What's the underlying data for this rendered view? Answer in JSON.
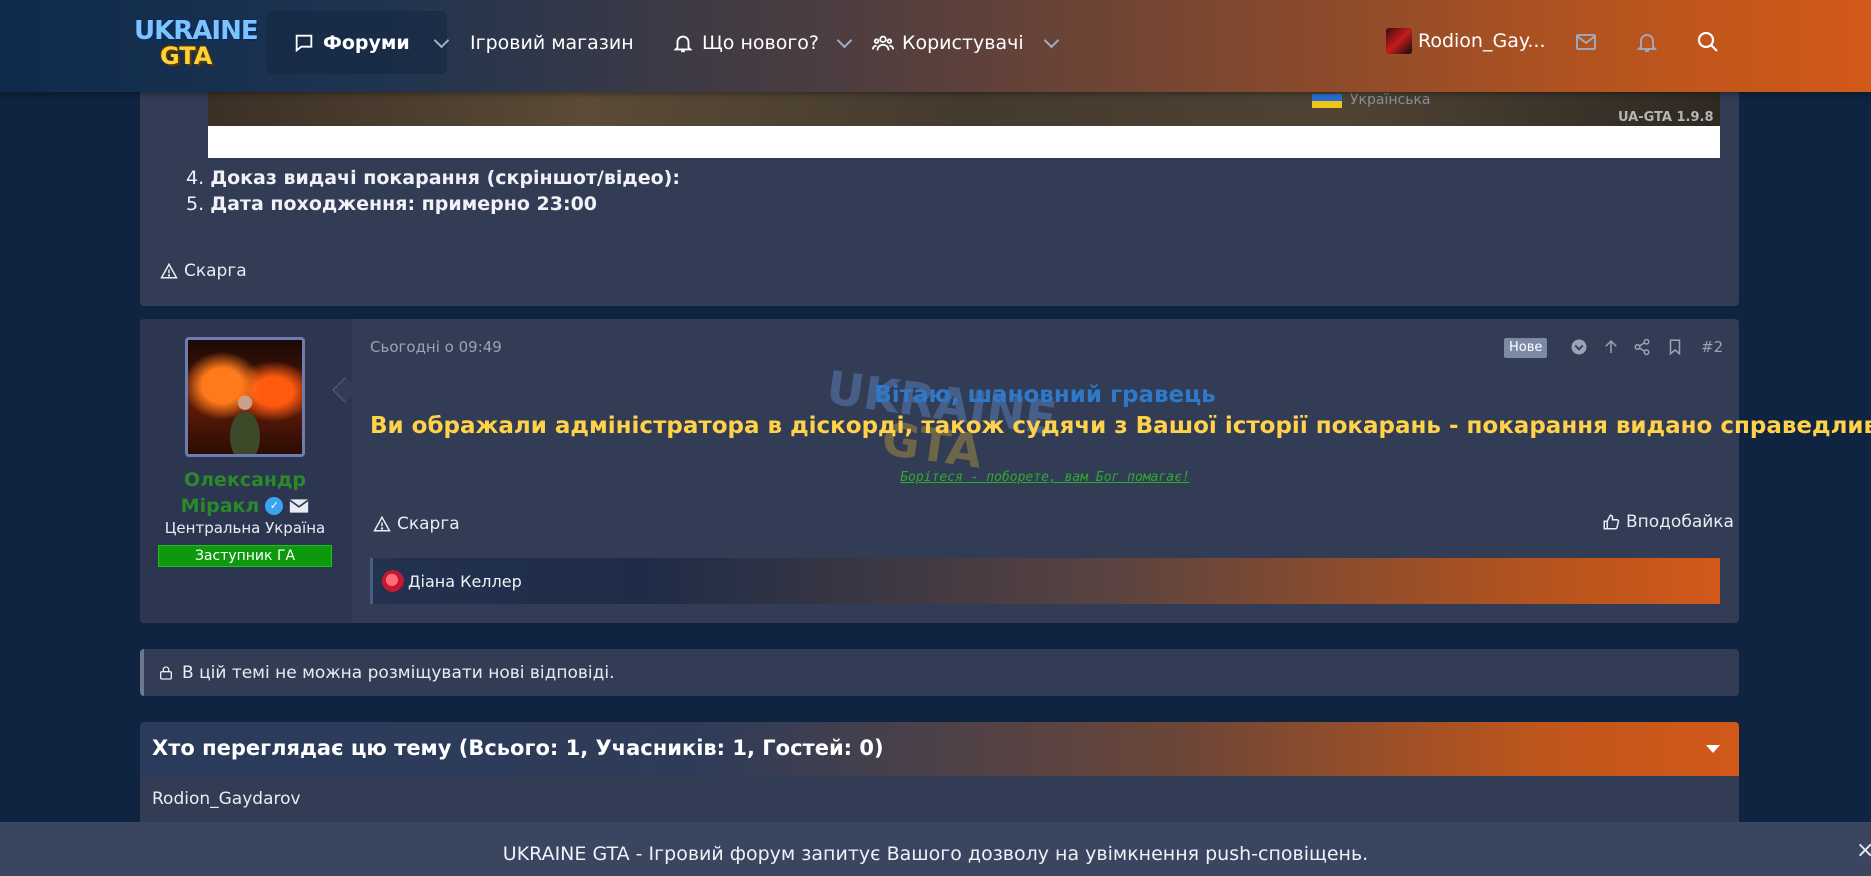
{
  "header": {
    "logo": {
      "line1": "UKRAINE",
      "line2": "GTA"
    },
    "nav": [
      {
        "label": "Форуми",
        "icon": "chat-bubble-icon",
        "dropdown": true,
        "active": true
      },
      {
        "label": "Ігровий магазин",
        "dropdown": false
      },
      {
        "label": "Що нового?",
        "icon": "bell-icon",
        "dropdown": true
      },
      {
        "label": "Користувачі",
        "icon": "users-icon",
        "dropdown": true
      }
    ],
    "user": {
      "name": "Rodion_Gay..."
    },
    "icons": [
      "envelope-icon",
      "bell-icon",
      "search-icon"
    ]
  },
  "previous_post": {
    "banner_language": "Українська",
    "banner_version": "UA-GTA 1.9.8",
    "items": [
      {
        "num": "4.",
        "text": "Доказ видачі покарання (скріншот/відео):"
      },
      {
        "num": "5.",
        "text": "Дата походження: примерно 23:00"
      }
    ],
    "report_label": "Скарга"
  },
  "post": {
    "author": {
      "name_line1": "Олександр",
      "name_line2": "Міракл",
      "verified_mark": "✓",
      "title": "Центральна Україна",
      "badge": "Заступник ГА"
    },
    "date": "Сьогодні о 09:49",
    "new_badge": "Нове",
    "number": "#2",
    "watermark": {
      "line1": "UKRAINE",
      "line2": "GTA"
    },
    "greeting": "Вітаю, шановний гравець",
    "verdict": "Ви ображали адміністратора в діскорді, також судячи з Вашої історії покарань - покарання видано справедливо.",
    "motto": "Борітеся - поборете, вам Бог помагає!",
    "report_label": "Скарга",
    "like_label": "Вподобайка",
    "likers": [
      "Діана Келлер"
    ]
  },
  "locked_notice": "В цій темі не можна розміщувати нові відповіді.",
  "viewers": {
    "title": "Хто переглядає цю тему (Всього: 1, Учасників: 1, Гостей: 0)",
    "names": [
      "Rodion_Gaydarov"
    ]
  },
  "push_notice": {
    "text": "UKRAINE GTA - Ігровий форум запитує Вашого дозволу на увімкнення push-сповіщень.",
    "close": "×"
  },
  "colors": {
    "accent_orange": "#d2591a",
    "navy": "#0f2440",
    "panel": "#333c55",
    "username_green": "#2a8a2a",
    "verdict_yellow": "#ffd24a",
    "greeting_blue": "#2e79c9",
    "badge_green": "#0c9a0c"
  }
}
